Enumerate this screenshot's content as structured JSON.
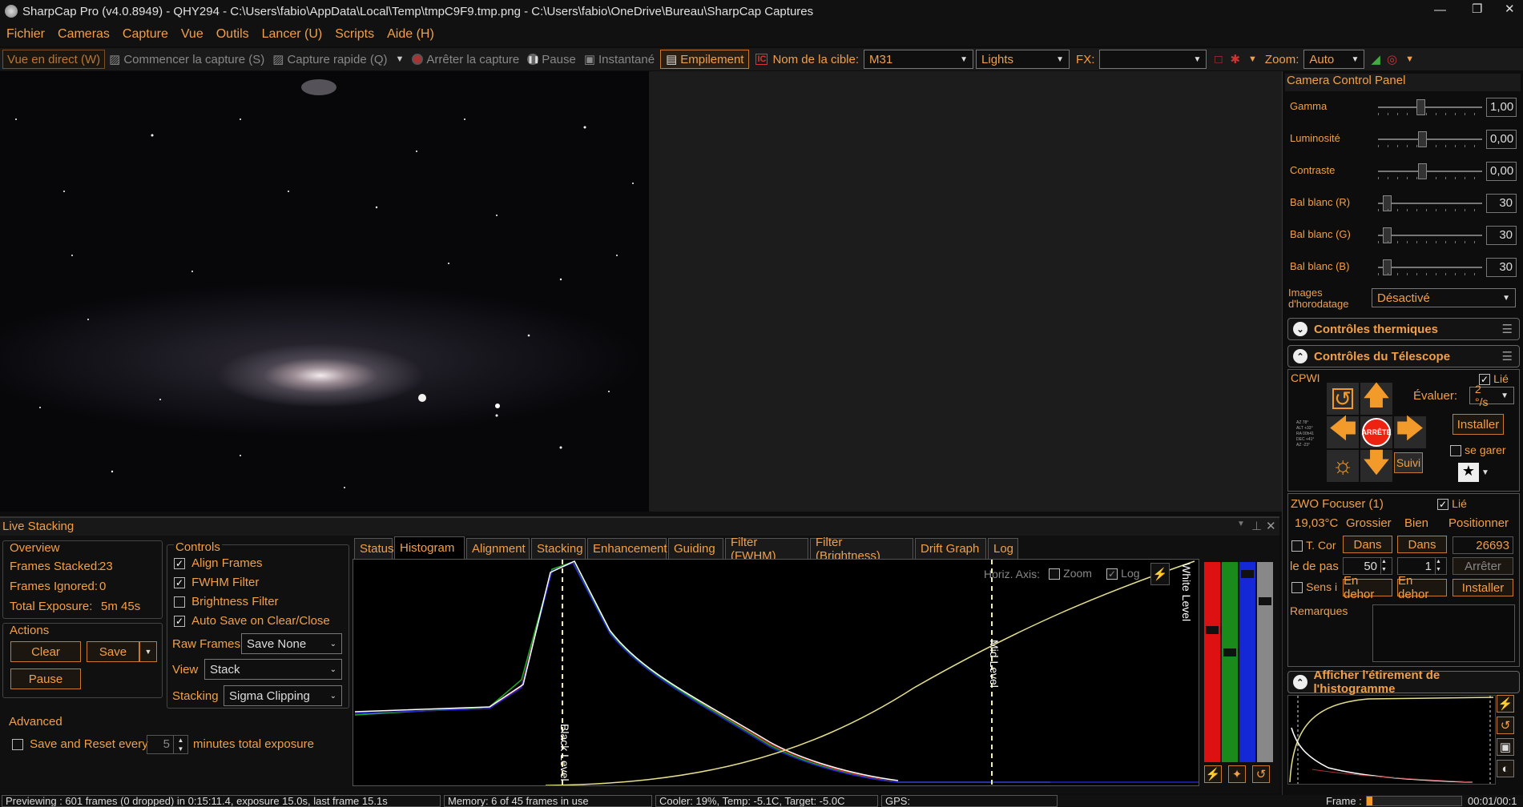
{
  "window": {
    "title": "SharpCap Pro (v4.0.8949) - QHY294 - C:\\Users\\fabio\\AppData\\Local\\Temp\\tmpC9F9.tmp.png - C:\\Users\\fabio\\OneDrive\\Bureau\\SharpCap Captures"
  },
  "menu": [
    "Fichier",
    "Cameras",
    "Capture",
    "Vue",
    "Outils",
    "Lancer (U)",
    "Scripts",
    "Aide (H)"
  ],
  "toolbar": {
    "live_view": "Vue en direct (W)",
    "start_capture": "Commencer la capture (S)",
    "quick_capture": "Capture rapide (Q)",
    "stop_capture": "Arrêter la capture",
    "pause": "Pause",
    "snapshot": "Instantané",
    "stacking": "Empilement",
    "target_label": "Nom de la cible:",
    "target_value": "M31",
    "frame_type": "Lights",
    "fx_label": "FX:",
    "fx_value": "",
    "zoom_label": "Zoom:",
    "zoom_value": "Auto"
  },
  "camera_panel": {
    "title": "Camera Control Panel",
    "controls": [
      {
        "label": "Gamma",
        "value": "1,00",
        "level": 0.4
      },
      {
        "label": "Luminosité",
        "value": "0,00",
        "level": 0.42
      },
      {
        "label": "Contraste",
        "value": "0,00",
        "level": 0.42
      },
      {
        "label": "Bal blanc (R)",
        "value": "30",
        "level": 0.05
      },
      {
        "label": "Bal blanc (G)",
        "value": "30",
        "level": 0.05
      },
      {
        "label": "Bal blanc (B)",
        "value": "30",
        "level": 0.05
      }
    ],
    "timestamp_label": "Images d'horodatage",
    "timestamp_value": "Désactivé"
  },
  "thermal": {
    "title": "Contrôles thermiques"
  },
  "telescope": {
    "title": "Contrôles du Télescope",
    "name": "CPWI",
    "linked": "Lié",
    "rate_label": "Évaluer:",
    "rate_value": "2 °/s",
    "stop": "ARRÊTE",
    "track": "Suivi",
    "install": "Installer",
    "park": "se garer"
  },
  "focuser": {
    "title": "ZWO Focuser (1)",
    "linked": "Lié",
    "temp": "19,03°C",
    "coarse": "Grossier",
    "fine": "Bien",
    "position_label": "Positionner",
    "tcomp": "T. Cor",
    "in": "Dans",
    "position_value": "26693",
    "step_label": "le de pas",
    "step_coarse": "50",
    "step_fine": "1",
    "stop": "Arrêter",
    "sense": "Sens i",
    "out": "En dehor",
    "install": "Installer",
    "notes_label": "Remarques"
  },
  "hist_stretch": {
    "title": "Afficher l'étirement de l'histogramme"
  },
  "live_stacking": {
    "title": "Live Stacking",
    "overview": {
      "title": "Overview",
      "frames_stacked_label": "Frames Stacked:",
      "frames_stacked": "23",
      "frames_ignored_label": "Frames Ignored:",
      "frames_ignored": "0",
      "total_exposure_label": "Total Exposure:",
      "total_exposure": "5m 45s"
    },
    "actions": {
      "title": "Actions",
      "clear": "Clear",
      "save": "Save",
      "pause": "Pause"
    },
    "advanced": {
      "title": "Advanced",
      "save_reset": "Save and Reset every",
      "minutes": "5",
      "suffix": "minutes total exposure"
    },
    "controls": {
      "title": "Controls",
      "align": "Align Frames",
      "fwhm": "FWHM Filter",
      "brightness": "Brightness Filter",
      "autosave": "Auto Save on Clear/Close",
      "raw_label": "Raw Frames",
      "raw_value": "Save None",
      "view_label": "View",
      "view_value": "Stack",
      "stacking_label": "Stacking",
      "stacking_value": "Sigma Clipping"
    },
    "tabs": [
      "Status",
      "Histogram",
      "Alignment",
      "Stacking",
      "Enhancement",
      "Guiding",
      "Filter (FWHM)",
      "Filter (Brightness)",
      "Drift Graph",
      "Log"
    ],
    "histogram": {
      "horiz_axis": "Horiz. Axis:",
      "zoom": "Zoom",
      "log": "Log",
      "black_level": "Black Level",
      "mid_level": "Mid Level",
      "white_level": "White Level"
    }
  },
  "status": {
    "previewing": "Previewing : 601 frames (0 dropped) in 0:15:11.4, exposure 15.0s, last frame 15.1s",
    "memory": "Memory: 6 of 45 frames in use",
    "cooler": "Cooler: 19%, Temp: -5.1C, Target: -5.0C",
    "gps": "GPS:",
    "frame": "Frame :",
    "time": "00:01/00:1"
  }
}
